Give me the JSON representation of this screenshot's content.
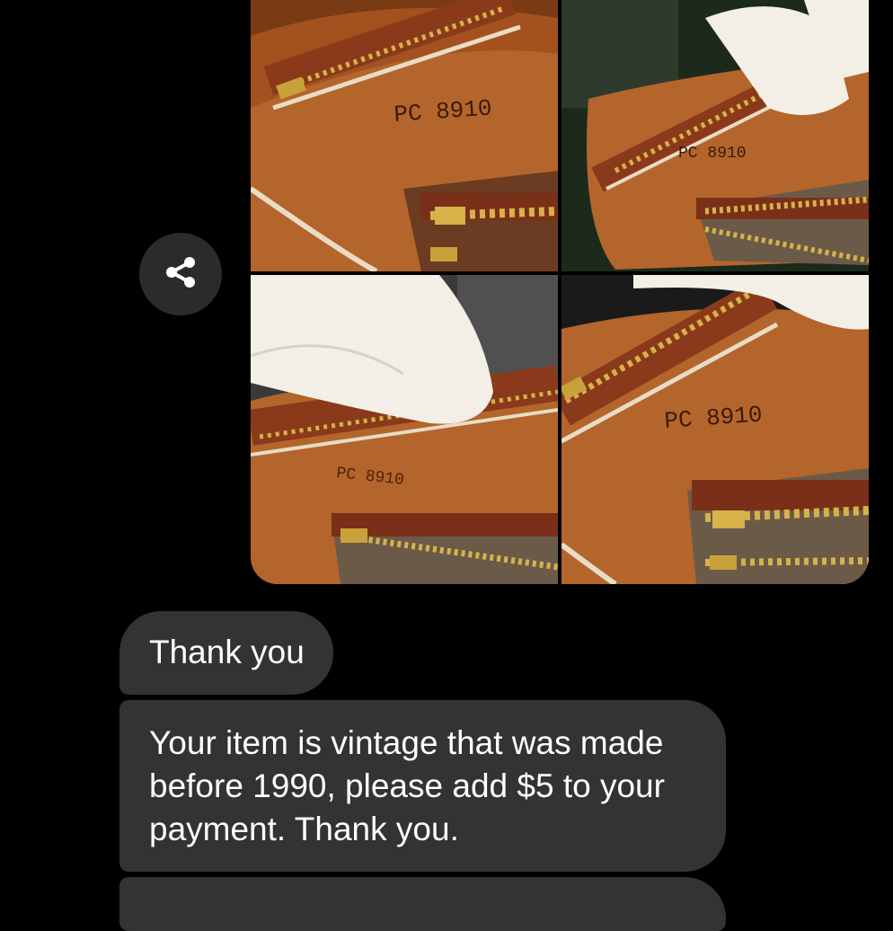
{
  "share": {
    "icon": "share-icon"
  },
  "photos": [
    {
      "stamp": "PC 8910"
    },
    {
      "stamp": "PC 8910"
    },
    {
      "stamp": "PC 8910"
    },
    {
      "stamp": "PC 8910"
    }
  ],
  "messages": [
    {
      "text": "Thank you"
    },
    {
      "text": "Your item is vintage that was made before 1990, please add $5 to your payment. Thank you."
    }
  ],
  "colors": {
    "background": "#000000",
    "bubble": "#333335",
    "text": "#ffffff",
    "leather": "#b4652b"
  }
}
